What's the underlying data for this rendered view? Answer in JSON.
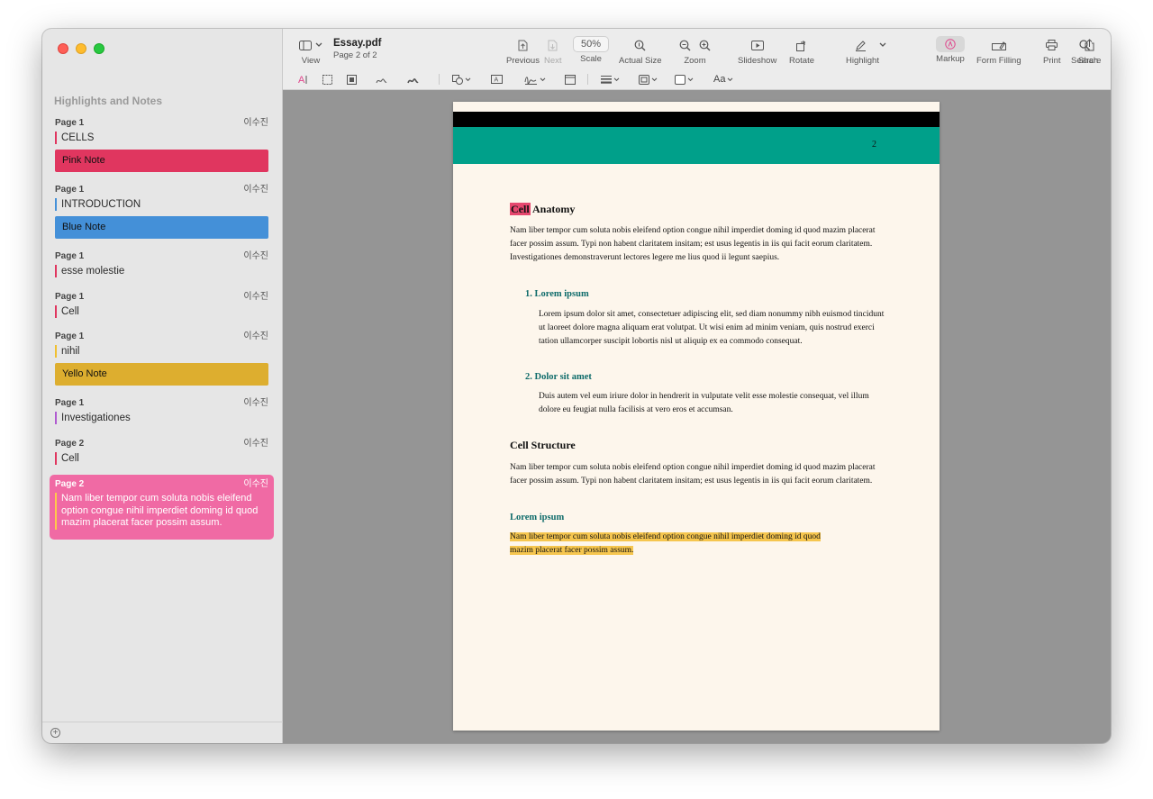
{
  "window": {
    "title": "Essay.pdf",
    "subtitle": "Page 2 of 2"
  },
  "sidebar": {
    "title": "Highlights and Notes",
    "notes": [
      {
        "page": "Page 1",
        "author": "이수진",
        "text": "CELLS",
        "bar_color": "#e0365f",
        "box": "Pink Note",
        "box_color": "#e0365f"
      },
      {
        "page": "Page 1",
        "author": "이수진",
        "text": "INTRODUCTION",
        "bar_color": "#4490d8",
        "box": "Blue Note",
        "box_color": "#4490d8"
      },
      {
        "page": "Page 1",
        "author": "이수진",
        "text": "esse molestie",
        "bar_color": "#e0365f"
      },
      {
        "page": "Page 1",
        "author": "이수진",
        "text": "Cell",
        "bar_color": "#e0365f"
      },
      {
        "page": "Page 1",
        "author": "이수진",
        "text": "nihil",
        "bar_color": "#f0c030",
        "box": "Yello Note",
        "box_color": "#ddae2f"
      },
      {
        "page": "Page 1",
        "author": "이수진",
        "text": "Investigationes",
        "bar_color": "#b05bd0"
      },
      {
        "page": "Page 2",
        "author": "이수진",
        "text": "Cell",
        "bar_color": "#e0365f"
      },
      {
        "page": "Page 2",
        "author": "이수진",
        "text": "Nam liber tempor cum soluta nobis eleifend option congue nihil imperdiet doming id quod mazim placerat facer possim assum.",
        "selected": true
      }
    ]
  },
  "toolbar": {
    "view": "View",
    "previous": "Previous",
    "next": "Next",
    "scale_value": "50%",
    "scale": "Scale",
    "actual_size": "Actual Size",
    "zoom": "Zoom",
    "slideshow": "Slideshow",
    "rotate": "Rotate",
    "highlight": "Highlight",
    "markup": "Markup",
    "form_filling": "Form Filling",
    "print": "Print",
    "share": "Share",
    "search": "Search",
    "font_button": "Aa"
  },
  "page": {
    "number": "2",
    "section1_title_highlight": "Cell",
    "section1_title_rest": " Anatomy",
    "section1_para": "Nam liber tempor cum soluta nobis eleifend option congue nihil imperdiet doming id quod mazim placerat facer possim assum. Typi non habent claritatem insitam; est usus legentis in iis qui facit eorum claritatem. Investigationes demonstraverunt lectores legere me lius quod ii legunt saepius.",
    "item1_title": "1.  Lorem ipsum",
    "item1_para": "Lorem ipsum dolor sit amet, consectetuer adipiscing elit, sed diam nonummy nibh euismod tincidunt ut laoreet dolore magna aliquam erat volutpat. Ut wisi enim ad minim veniam, quis nostrud exerci tation ullamcorper suscipit lobortis nisl ut aliquip ex ea commodo consequat.",
    "item2_title": "2.  Dolor sit amet",
    "item2_para": "Duis autem vel eum iriure dolor in hendrerit in vulputate velit esse molestie consequat, vel illum dolore eu feugiat nulla facilisis at vero eros et accumsan.",
    "section2_title": "Cell Structure",
    "section2_para": "Nam liber tempor cum soluta nobis eleifend option congue nihil imperdiet doming id quod mazim placerat facer possim assum. Typi non habent claritatem insitam; est usus legentis in iis qui facit eorum claritatem.",
    "sub_title": "Lorem ipsum",
    "highlight_para_line1": "Nam liber tempor cum soluta nobis eleifend option congue nihil imperdiet doming id quod",
    "highlight_para_line2": "mazim placerat facer possim assum."
  }
}
